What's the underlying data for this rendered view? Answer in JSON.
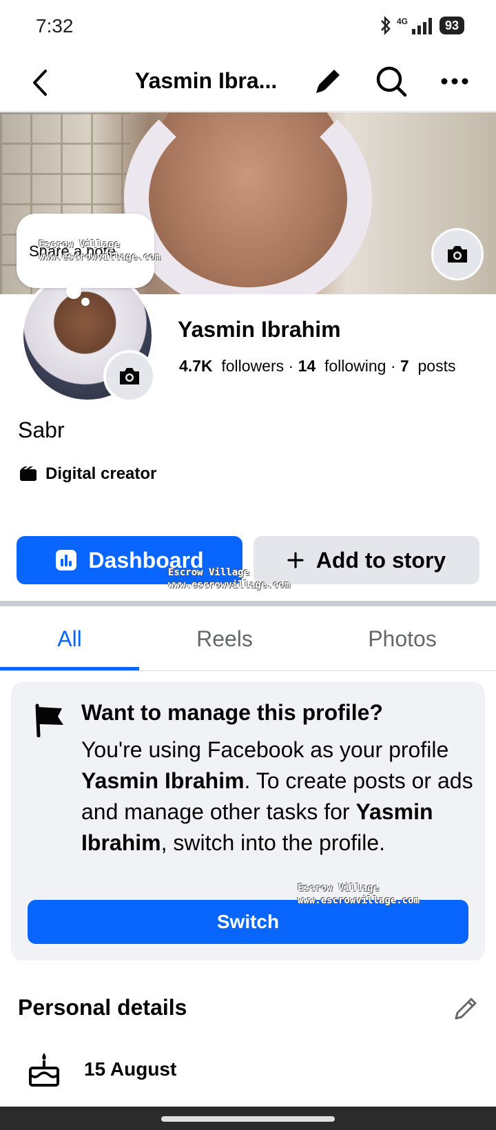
{
  "status_bar": {
    "time": "7:32",
    "network": "4G",
    "battery": "93"
  },
  "nav": {
    "title": "Yasmin Ibra..."
  },
  "note": {
    "placeholder": "Share a note..."
  },
  "profile": {
    "name": "Yasmin Ibrahim",
    "followers_count": "4.7K",
    "followers_label": "followers",
    "following_count": "14",
    "following_label": "following",
    "posts_count": "7",
    "posts_label": "posts",
    "separator": " · ",
    "bio": "Sabr",
    "category": "Digital creator"
  },
  "actions": {
    "dashboard_label": "Dashboard",
    "add_story_label": "Add to story"
  },
  "tabs": [
    {
      "label": "All"
    },
    {
      "label": "Reels"
    },
    {
      "label": "Photos"
    }
  ],
  "manage_card": {
    "title": "Want to manage this profile?",
    "body_1": "You're using Facebook as your profile ",
    "name_1": "Yasmin Ibrahim",
    "body_2": ". To create posts or ads and manage other tasks for ",
    "name_2": "Yasmin Ibrahim",
    "body_3": ", switch into the profile.",
    "switch_label": "Switch"
  },
  "personal_details": {
    "title": "Personal details",
    "birthday": "15 August"
  },
  "watermark": {
    "line1": "Escrow Village",
    "line2": "www.escrowvillage.com"
  },
  "colors": {
    "accent": "#0866ff",
    "secondary_button": "#e4e6eb",
    "card_bg": "#f0f2f5",
    "muted_text": "#65676b"
  }
}
